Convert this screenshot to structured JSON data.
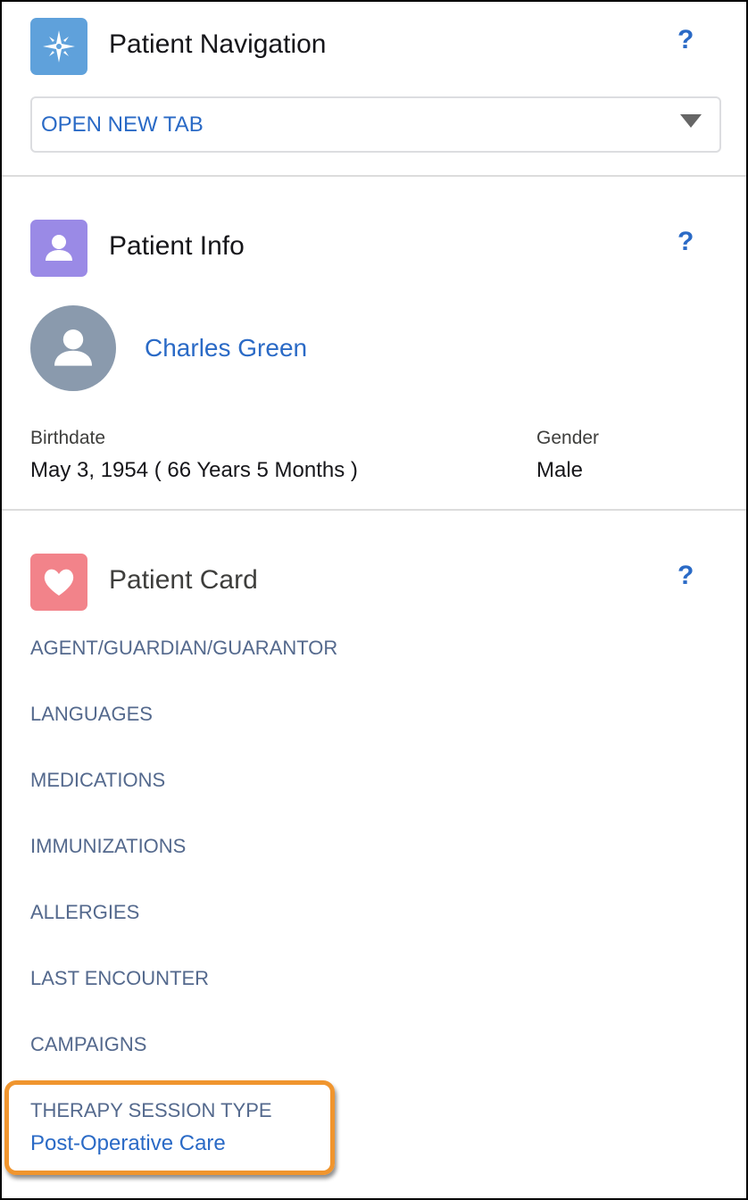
{
  "navigation": {
    "title": "Patient Navigation",
    "help": "?",
    "icon": "compass-icon",
    "dropdown_value": "OPEN NEW TAB"
  },
  "info": {
    "title": "Patient Info",
    "help": "?",
    "icon": "person-icon",
    "patient_name": "Charles Green",
    "birthdate_label": "Birthdate",
    "birthdate_value": "May 3, 1954 ( 66 Years 5 Months )",
    "gender_label": "Gender",
    "gender_value": "Male"
  },
  "card": {
    "title": "Patient Card",
    "help": "?",
    "icon": "heart-icon",
    "items": [
      "AGENT/GUARDIAN/GUARANTOR",
      "LANGUAGES",
      "MEDICATIONS",
      "IMMUNIZATIONS",
      "ALLERGIES",
      "LAST ENCOUNTER",
      "CAMPAIGNS"
    ],
    "highlight_label": "THERAPY SESSION TYPE",
    "highlight_value": "Post-Operative Care"
  },
  "colors": {
    "link": "#2a6ac6",
    "nav_icon": "#5fa1db",
    "info_icon": "#9a8ae6",
    "card_icon": "#f2838a",
    "highlight": "#f0952e"
  }
}
